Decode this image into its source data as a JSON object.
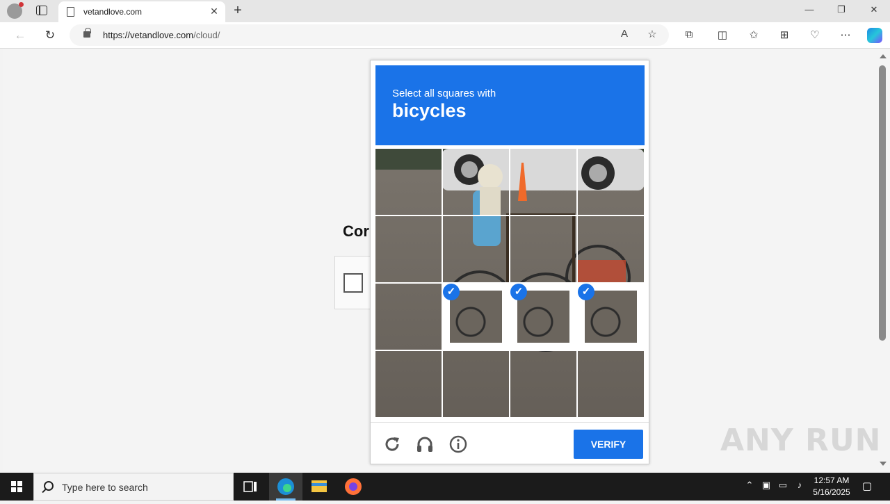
{
  "browser": {
    "tab_title": "vetandlove.com",
    "url_host": "https://vetandlove.com",
    "url_path": "/cloud/",
    "tab_close_glyph": "✕",
    "new_tab_glyph": "+",
    "window_controls": [
      "—",
      "❐",
      "✕"
    ]
  },
  "page": {
    "heading_partial": "Cor"
  },
  "captcha": {
    "instruction": "Select all squares with",
    "target": "bicycles",
    "selected_tiles": [
      9,
      10,
      11
    ],
    "verify_label": "VERIFY",
    "check_glyph": "✓",
    "colors": {
      "accent": "#1a73e8"
    }
  },
  "watermark": "ANY RUN",
  "taskbar": {
    "search_placeholder": "Type here to search",
    "time": "12:57 AM",
    "date": "5/16/2025"
  }
}
